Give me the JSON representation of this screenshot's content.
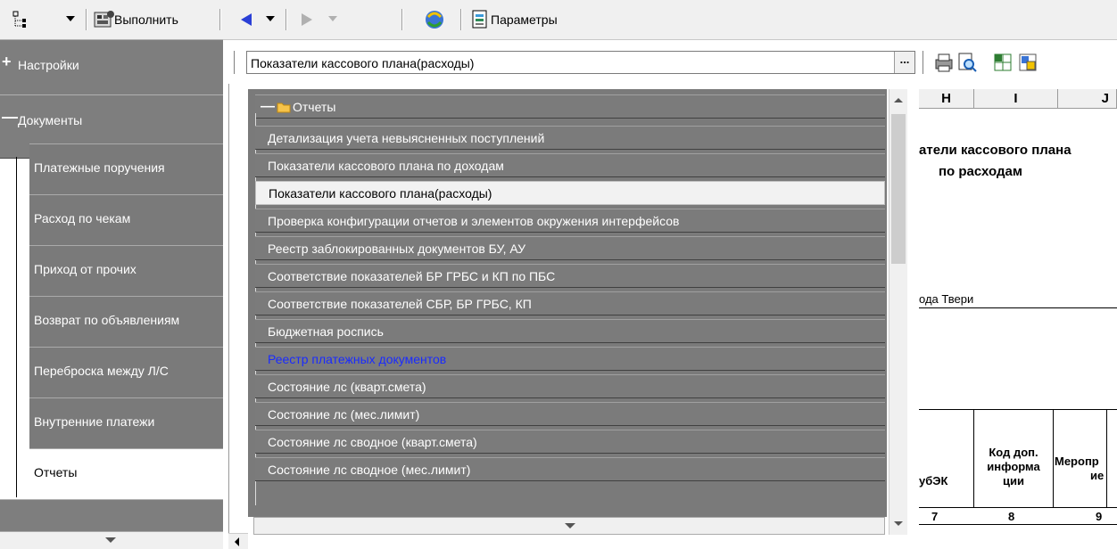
{
  "toolbar": {
    "run_label": "Выполнить",
    "params_label": "Параметры"
  },
  "leftnav": {
    "groups": [
      {
        "sign": "+",
        "label": "Настройки"
      },
      {
        "sign": "—",
        "label": "Документы"
      }
    ],
    "items": [
      {
        "label": "Платежные поручения"
      },
      {
        "label": "Расход по чекам"
      },
      {
        "label": "Приход от прочих"
      },
      {
        "label": "Возврат по объявлениям"
      },
      {
        "label": "Переброска между Л/С"
      },
      {
        "label": "Внутренние платежи"
      },
      {
        "label": "Отчеты",
        "active": true
      }
    ]
  },
  "combo": {
    "value": "Показатели кассового плана(расходы)",
    "button_label": "..."
  },
  "dropdown": {
    "root_label": "Отчеты",
    "items": [
      {
        "label": "Детализация учета невыясненных поступлений"
      },
      {
        "label": "Показатели кассового плана по доходам"
      },
      {
        "label": "Показатели кассового плана(расходы)",
        "selected": true
      },
      {
        "label": "Проверка конфигурации отчетов и элементов окружения интерфейсов"
      },
      {
        "label": "Реестр заблокированных документов БУ, АУ"
      },
      {
        "label": "Соответствие показателей БР ГРБС и КП по ПБС"
      },
      {
        "label": "Соответствие показателей СБР, БР ГРБС, КП"
      },
      {
        "label": "Бюджетная роспись"
      },
      {
        "label": "Реестр платежных документов",
        "link": true
      },
      {
        "label": "Состояние лс (кварт.смета)"
      },
      {
        "label": "Состояние лс (мес.лимит)"
      },
      {
        "label": "Состояние лс сводное (кварт.смета)"
      },
      {
        "label": "Состояние лс сводное (мес.лимит)"
      }
    ]
  },
  "sheet": {
    "columns": [
      "H",
      "I",
      "J"
    ],
    "title_line1": "атели кассового плана",
    "title_line2": "по расходам",
    "city_text": "ода Твери",
    "col_header_1": "убЭК",
    "col_header_2_l1": "Код доп.",
    "col_header_2_l2": "информа",
    "col_header_2_l3": "ции",
    "col_header_3_l1": "Меропр",
    "col_header_3_l2": "ие",
    "nums": [
      "7",
      "8",
      "9"
    ]
  },
  "colors": {
    "nav_bg": "#7a7a7a",
    "selected_bg": "#f2f2f2",
    "link_color": "#1a2bff"
  }
}
